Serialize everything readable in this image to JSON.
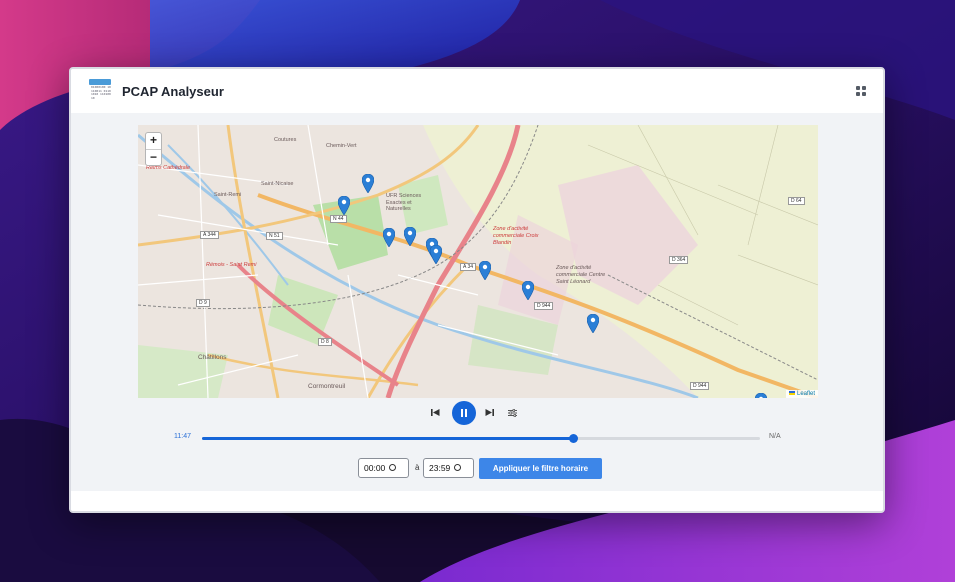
{
  "app": {
    "title": "PCAP Analyseur",
    "logo_text": "01000100 10110011 01101010 11010010"
  },
  "header": {
    "apps_icon": "grid-icon"
  },
  "map": {
    "zoom_in": "+",
    "zoom_out": "−",
    "attribution": "Leaflet",
    "labels": {
      "coutures": "Coutures",
      "chemin_vert": "Chemin-Vert",
      "reims_cathedrale": "Reims Cathédrale",
      "saint_nicaise": "Saint-Nicaise",
      "saint_remi": "Saint-Remi",
      "ufr": "UFR Sciences Exactes et Naturelles",
      "zone_croix": "Zone d'activité commerciale Croix Blandin",
      "zone_centre": "Zone d'activité commerciale Centre Saint Léonard",
      "chatillons": "Châtillons",
      "cormontreuil": "Cormontreuil",
      "remois": "Rémois - Saint Remi"
    },
    "shields": [
      "N 44",
      "A 344",
      "N 51",
      "A 34",
      "D 944",
      "D 9",
      "D 8",
      "D 364",
      "D 64",
      "D 944"
    ]
  },
  "player": {
    "current_time": "11:47",
    "end_time": "N/A",
    "progress_fraction": 0.665
  },
  "filter": {
    "start": "00:00",
    "end": "23:59",
    "separator": "à",
    "apply_label": "Appliquer le filtre horaire"
  }
}
